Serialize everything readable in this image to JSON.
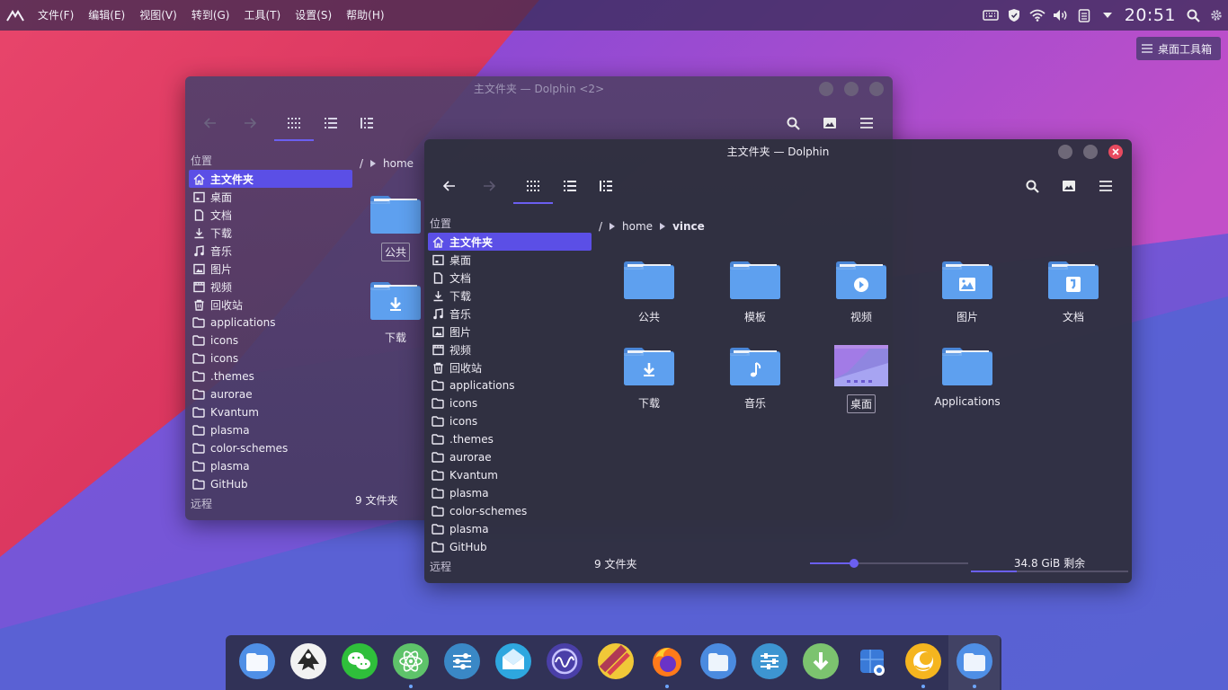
{
  "top_panel": {
    "menus": [
      "文件(F)",
      "编辑(E)",
      "视图(V)",
      "转到(G)",
      "工具(T)",
      "设置(S)",
      "帮助(H)"
    ],
    "tray_icons": [
      "keyboard-icon",
      "shield-icon",
      "wifi-icon",
      "volume-icon",
      "clipboard-icon",
      "chevron-down-icon"
    ],
    "clock": "20:51",
    "search_icon": "search-icon",
    "settings_icon": "gear-icon"
  },
  "desktop_toolbox": {
    "label": "桌面工具箱"
  },
  "back_window": {
    "title": "主文件夹 — Dolphin <2>",
    "sidebar_heading": "位置",
    "sidebar_items": [
      {
        "label": "主文件夹",
        "icon": "home-icon",
        "selected": true
      },
      {
        "label": "桌面",
        "icon": "desktop-icon"
      },
      {
        "label": "文档",
        "icon": "document-icon"
      },
      {
        "label": "下载",
        "icon": "download-icon"
      },
      {
        "label": "音乐",
        "icon": "music-icon"
      },
      {
        "label": "图片",
        "icon": "picture-icon"
      },
      {
        "label": "视频",
        "icon": "video-icon"
      },
      {
        "label": "回收站",
        "icon": "trash-icon"
      },
      {
        "label": "applications",
        "icon": "folder-icon"
      },
      {
        "label": "icons",
        "icon": "folder-icon"
      },
      {
        "label": "icons",
        "icon": "folder-icon"
      },
      {
        "label": ".themes",
        "icon": "folder-icon"
      },
      {
        "label": "aurorae",
        "icon": "folder-icon"
      },
      {
        "label": "Kvantum",
        "icon": "folder-icon"
      },
      {
        "label": "plasma",
        "icon": "folder-icon"
      },
      {
        "label": "color-schemes",
        "icon": "folder-icon"
      },
      {
        "label": "plasma",
        "icon": "folder-icon"
      },
      {
        "label": "GitHub",
        "icon": "folder-icon"
      }
    ],
    "sidebar_heading2": "远程",
    "breadcrumb": [
      "/",
      "home"
    ],
    "files": [
      {
        "label": "公共",
        "icon": "folder-icon"
      },
      {
        "label": "下载",
        "icon": "folder-download-icon"
      }
    ],
    "status": "9 文件夹"
  },
  "front_window": {
    "title": "主文件夹 — Dolphin",
    "sidebar_heading": "位置",
    "sidebar_items": [
      {
        "label": "主文件夹",
        "icon": "home-icon",
        "selected": true
      },
      {
        "label": "桌面",
        "icon": "desktop-icon"
      },
      {
        "label": "文档",
        "icon": "document-icon"
      },
      {
        "label": "下载",
        "icon": "download-icon"
      },
      {
        "label": "音乐",
        "icon": "music-icon"
      },
      {
        "label": "图片",
        "icon": "picture-icon"
      },
      {
        "label": "视频",
        "icon": "video-icon"
      },
      {
        "label": "回收站",
        "icon": "trash-icon"
      },
      {
        "label": "applications",
        "icon": "folder-icon"
      },
      {
        "label": "icons",
        "icon": "folder-icon"
      },
      {
        "label": "icons",
        "icon": "folder-icon"
      },
      {
        "label": ".themes",
        "icon": "folder-icon"
      },
      {
        "label": "aurorae",
        "icon": "folder-icon"
      },
      {
        "label": "Kvantum",
        "icon": "folder-icon"
      },
      {
        "label": "plasma",
        "icon": "folder-icon"
      },
      {
        "label": "color-schemes",
        "icon": "folder-icon"
      },
      {
        "label": "plasma",
        "icon": "folder-icon"
      },
      {
        "label": "GitHub",
        "icon": "folder-icon"
      }
    ],
    "sidebar_heading2": "远程",
    "breadcrumb": [
      "/",
      "home",
      "vince"
    ],
    "files": [
      {
        "label": "公共",
        "icon": "folder-icon"
      },
      {
        "label": "模板",
        "icon": "folder-icon"
      },
      {
        "label": "视频",
        "icon": "folder-video-icon"
      },
      {
        "label": "图片",
        "icon": "folder-picture-icon"
      },
      {
        "label": "文档",
        "icon": "folder-document-icon"
      },
      {
        "label": "下载",
        "icon": "folder-download-icon"
      },
      {
        "label": "音乐",
        "icon": "folder-music-icon"
      },
      {
        "label": "桌面",
        "icon": "desktop-thumbnail-icon"
      },
      {
        "label": "Applications",
        "icon": "folder-icon"
      }
    ],
    "status": "9 文件夹",
    "zoom_level": 0.28,
    "free_space": "34.8 GiB 剩余",
    "used_fraction": 0.29
  },
  "colors": {
    "accent": "#6b5ff0",
    "folder": "#5ea0ef",
    "close": "#e84a5f"
  },
  "dock": [
    {
      "name": "dolphin-icon",
      "running": false
    },
    {
      "name": "inkscape-icon",
      "running": false
    },
    {
      "name": "wechat-icon",
      "running": false
    },
    {
      "name": "atom-icon",
      "running": true
    },
    {
      "name": "settings-sliders-icon",
      "running": false
    },
    {
      "name": "mail-icon",
      "running": false
    },
    {
      "name": "system-monitor-icon",
      "running": false
    },
    {
      "name": "color-app-icon",
      "running": false
    },
    {
      "name": "firefox-icon",
      "running": true
    },
    {
      "name": "files-icon",
      "running": false
    },
    {
      "name": "mixer-icon",
      "running": false
    },
    {
      "name": "downloader-icon",
      "running": false
    },
    {
      "name": "screenshot-icon",
      "running": false
    },
    {
      "name": "chat-app-icon",
      "running": true
    },
    {
      "name": "file-manager-icon",
      "running": true
    }
  ]
}
